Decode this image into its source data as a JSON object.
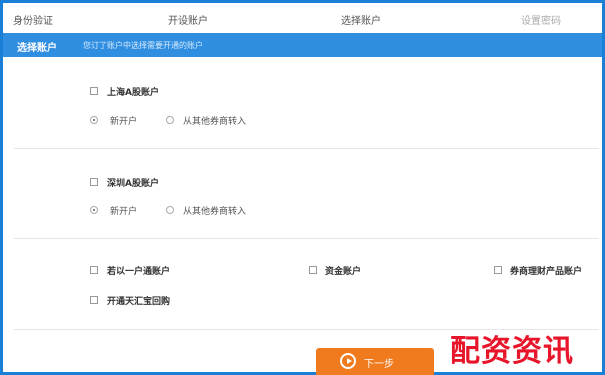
{
  "steps": [
    {
      "label": "身份验证"
    },
    {
      "label": "开设账户"
    },
    {
      "label": "选择账户"
    },
    {
      "label": "设置密码"
    }
  ],
  "banner": {
    "title": "选择账户",
    "hint": "您订了账户中选择需要开通的账户"
  },
  "groups": [
    {
      "name": "上海A股账户",
      "checked": false,
      "options": [
        {
          "label": "新开户",
          "selected": true
        },
        {
          "label": "从其他券商转入",
          "selected": false
        }
      ]
    },
    {
      "name": "深圳A股账户",
      "checked": false,
      "options": [
        {
          "label": "新开户",
          "selected": true
        },
        {
          "label": "从其他券商转入",
          "selected": false
        }
      ]
    }
  ],
  "extras": [
    {
      "label": "若以一户通账户",
      "checked": false
    },
    {
      "label": "资金账户",
      "checked": false
    },
    {
      "label": "券商理财产品账户",
      "checked": false
    },
    {
      "label": "开通天汇宝回购",
      "checked": false
    }
  ],
  "next_button": {
    "label": "下一步",
    "icon": "arrow-right-circle-icon"
  },
  "watermark": "配资资讯",
  "colors": {
    "accent": "#2f8ee0",
    "border": "#1a7fd6",
    "button": "#f07a1e",
    "watermark": "#e8152a"
  }
}
